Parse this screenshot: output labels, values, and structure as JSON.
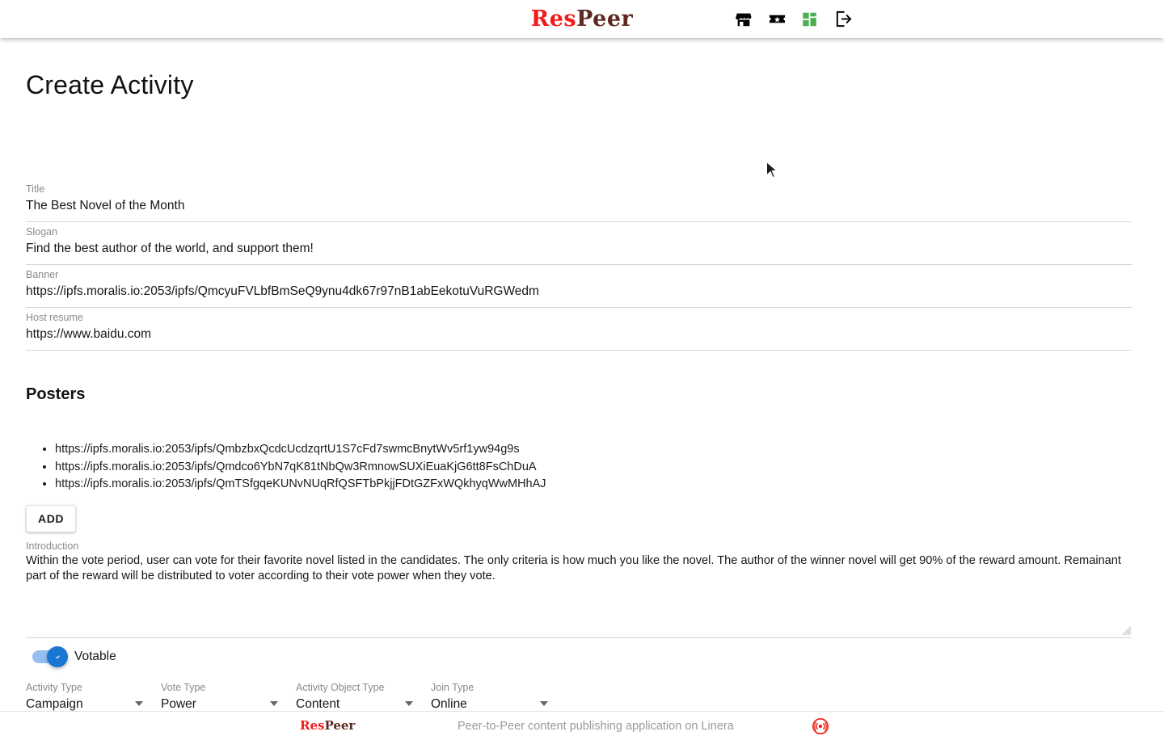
{
  "header": {
    "brand_prefix": "Res",
    "brand_suffix": "Peer",
    "icons": [
      {
        "name": "store-icon",
        "label": "Store"
      },
      {
        "name": "ticket-star-icon",
        "label": "Activity"
      },
      {
        "name": "grid-apps-icon",
        "label": "Applications"
      },
      {
        "name": "logout-icon",
        "label": "Logout"
      }
    ]
  },
  "page": {
    "title": "Create Activity"
  },
  "fields": [
    {
      "label": "Title",
      "value": "The Best Novel of the Month"
    },
    {
      "label": "Slogan",
      "value": "Find the best author of the world, and support them!"
    },
    {
      "label": "Banner",
      "value": "https://ipfs.moralis.io:2053/ipfs/QmcyuFVLbfBmSeQ9ynu4dk67r97nB1abEekotuVuRGWedm"
    },
    {
      "label": "Host resume",
      "value": "https://www.baidu.com"
    }
  ],
  "posters": {
    "section_title": "Posters",
    "items": [
      "https://ipfs.moralis.io:2053/ipfs/QmbzbxQcdcUcdzqrtU1S7cFd7swmcBnytWv5rf1yw94g9s",
      "https://ipfs.moralis.io:2053/ipfs/Qmdco6YbN7qK81tNbQw3RmnowSUXiEuaKjG6tt8FsChDuA",
      "https://ipfs.moralis.io:2053/ipfs/QmTSfgqeKUNvNUqRfQSFTbPkjjFDtGZFxWQkhyqWwMHhAJ"
    ],
    "add_label": "ADD"
  },
  "introduction": {
    "label": "Introduction",
    "value": "Within the vote period, user can vote for their favorite novel listed in the candidates. The only criteria is how much you like the novel. The author of the winner novel will get 90% of the reward amount. Remainant part of the reward will be distributed to voter according to their vote power when they vote."
  },
  "votable": {
    "label": "Votable",
    "checked": true,
    "accent": "#1976d2"
  },
  "selects": [
    {
      "label": "Activity Type",
      "value": "Campaign"
    },
    {
      "label": "Vote Type",
      "value": "Power"
    },
    {
      "label": "Activity Object Type",
      "value": "Content"
    },
    {
      "label": "Join Type",
      "value": "Online"
    }
  ],
  "footer": {
    "brand_prefix": "Res",
    "brand_suffix": "Peer",
    "tagline": "Peer-to-Peer content publishing application on Linera",
    "logo_name": "linera-logo-icon"
  },
  "colors": {
    "brand_red": "#f21b1b",
    "brand_dark": "#5c2a22",
    "accent_blue": "#1976d2",
    "grid_green": "#4caf50"
  }
}
